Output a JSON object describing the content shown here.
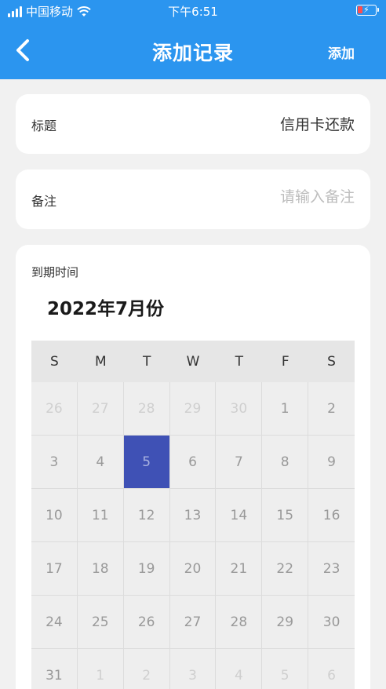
{
  "status": {
    "carrier": "中国移动",
    "time": "下午6:51"
  },
  "nav": {
    "title": "添加记录",
    "add_label": "添加"
  },
  "title_row": {
    "label": "标题",
    "value": "信用卡还款"
  },
  "note_row": {
    "label": "备注",
    "placeholder": "请输入备注"
  },
  "due": {
    "label": "到期时间",
    "month": "2022年7月份"
  },
  "calendar": {
    "weekdays": [
      "S",
      "M",
      "T",
      "W",
      "T",
      "F",
      "S"
    ],
    "days": [
      {
        "d": "26",
        "o": true
      },
      {
        "d": "27",
        "o": true
      },
      {
        "d": "28",
        "o": true
      },
      {
        "d": "29",
        "o": true
      },
      {
        "d": "30",
        "o": true
      },
      {
        "d": "1",
        "o": false
      },
      {
        "d": "2",
        "o": false
      },
      {
        "d": "3",
        "o": false
      },
      {
        "d": "4",
        "o": false
      },
      {
        "d": "5",
        "o": false,
        "sel": true
      },
      {
        "d": "6",
        "o": false
      },
      {
        "d": "7",
        "o": false
      },
      {
        "d": "8",
        "o": false
      },
      {
        "d": "9",
        "o": false
      },
      {
        "d": "10",
        "o": false
      },
      {
        "d": "11",
        "o": false
      },
      {
        "d": "12",
        "o": false
      },
      {
        "d": "13",
        "o": false
      },
      {
        "d": "14",
        "o": false
      },
      {
        "d": "15",
        "o": false
      },
      {
        "d": "16",
        "o": false
      },
      {
        "d": "17",
        "o": false
      },
      {
        "d": "18",
        "o": false
      },
      {
        "d": "19",
        "o": false
      },
      {
        "d": "20",
        "o": false
      },
      {
        "d": "21",
        "o": false
      },
      {
        "d": "22",
        "o": false
      },
      {
        "d": "23",
        "o": false
      },
      {
        "d": "24",
        "o": false
      },
      {
        "d": "25",
        "o": false
      },
      {
        "d": "26",
        "o": false
      },
      {
        "d": "27",
        "o": false
      },
      {
        "d": "28",
        "o": false
      },
      {
        "d": "29",
        "o": false
      },
      {
        "d": "30",
        "o": false
      },
      {
        "d": "31",
        "o": false
      },
      {
        "d": "1",
        "o": true
      },
      {
        "d": "2",
        "o": true
      },
      {
        "d": "3",
        "o": true
      },
      {
        "d": "4",
        "o": true
      },
      {
        "d": "5",
        "o": true
      },
      {
        "d": "6",
        "o": true
      }
    ]
  },
  "colors": {
    "header": "#2b95ef",
    "selected": "#3f51b5",
    "background": "#f1f1f1"
  }
}
